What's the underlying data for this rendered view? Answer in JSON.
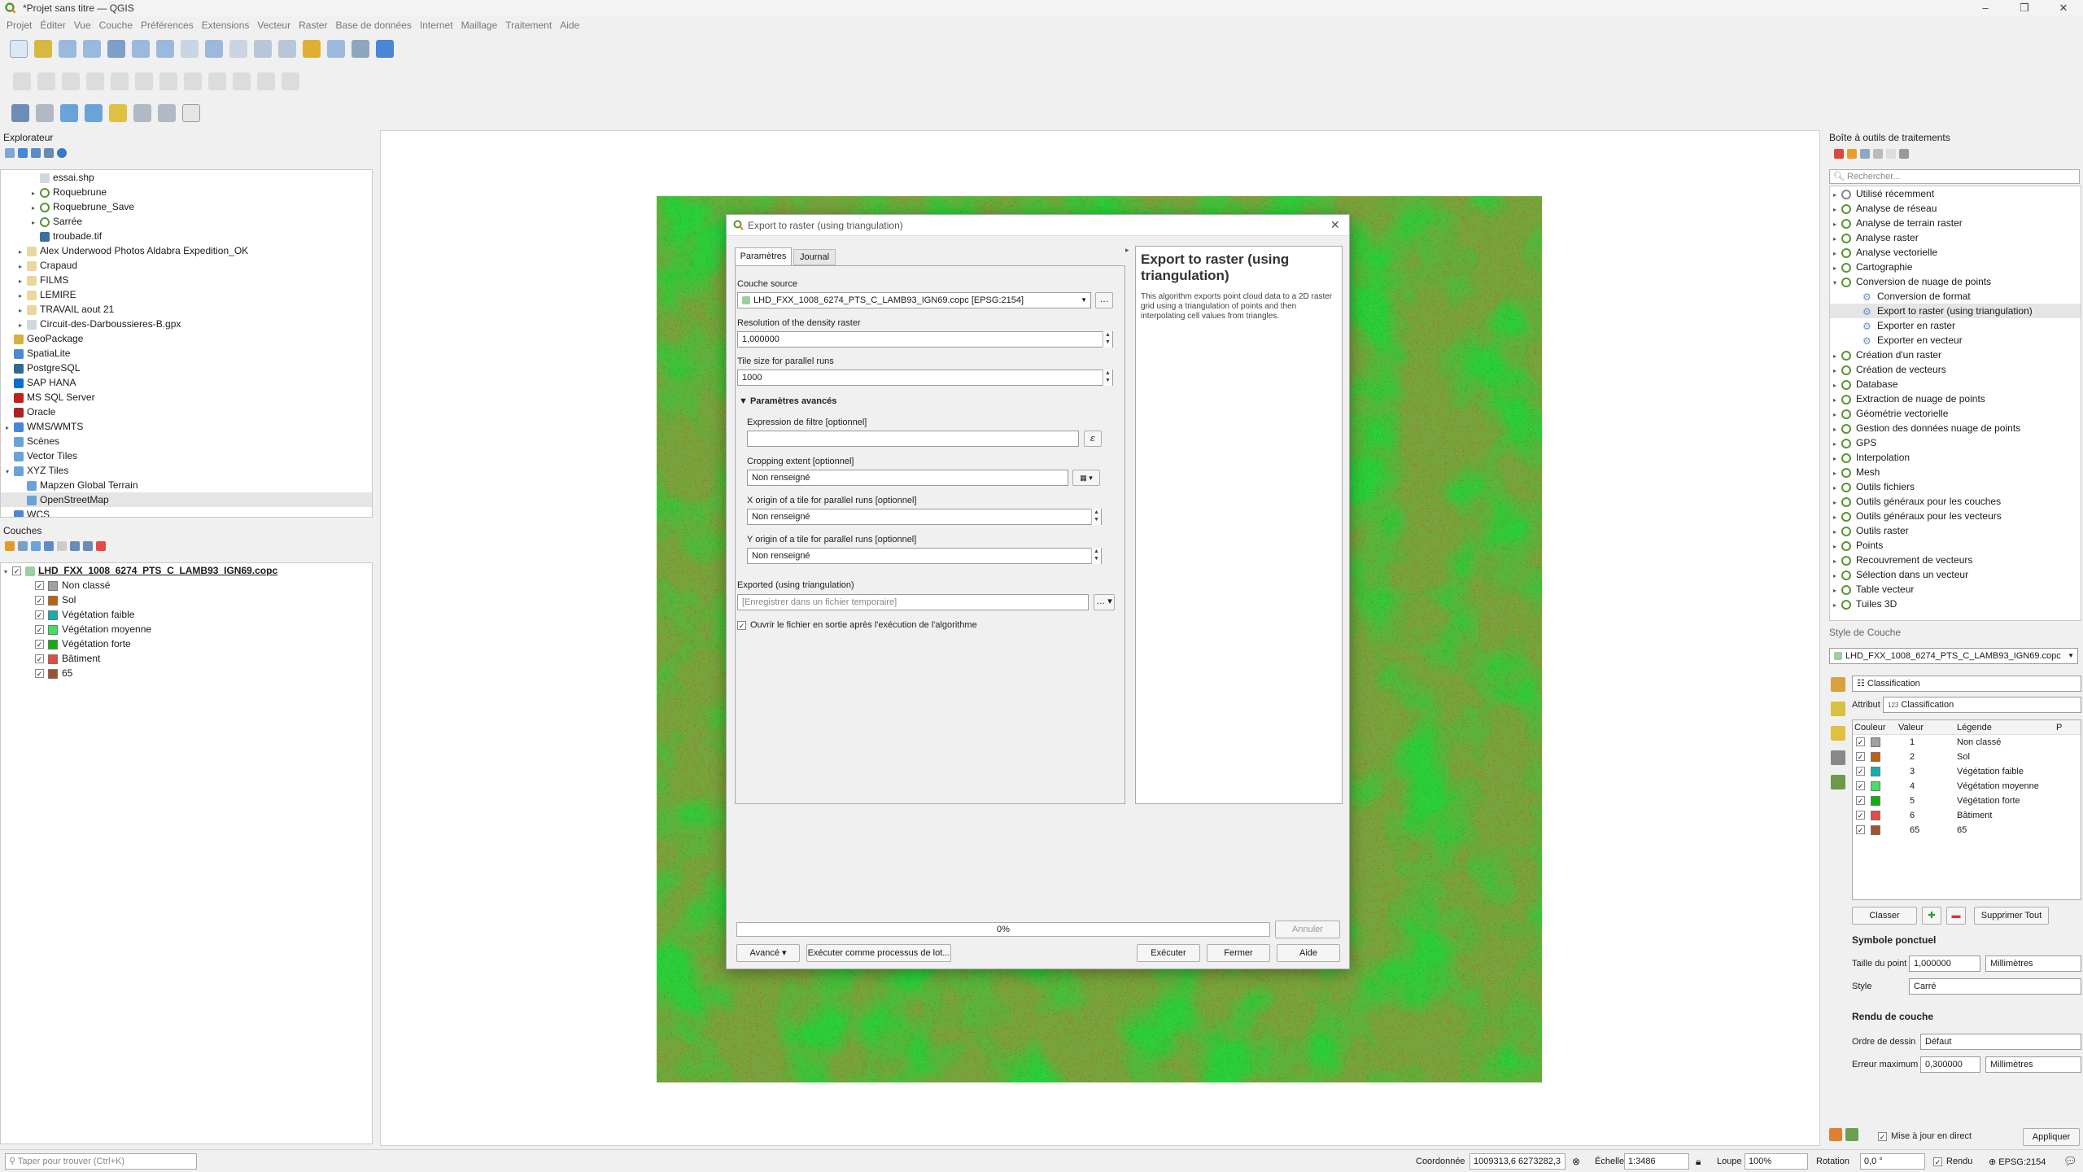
{
  "window": {
    "title": "*Projet sans titre — QGIS"
  },
  "menu": [
    "Projet",
    "Éditer",
    "Vue",
    "Couche",
    "Préférences",
    "Extensions",
    "Vecteur",
    "Raster",
    "Base de données",
    "Internet",
    "Maillage",
    "Traitement",
    "Aide"
  ],
  "explorer": {
    "title": "Explorateur",
    "items": [
      {
        "label": "essai.shp",
        "indent": 2,
        "icon": "file"
      },
      {
        "label": "Roquebrune",
        "indent": 2,
        "icon": "qgs",
        "arrow": "▸"
      },
      {
        "label": "Roquebrune_Save",
        "indent": 2,
        "icon": "qgs",
        "arrow": "▸"
      },
      {
        "label": "Sarrée",
        "indent": 2,
        "icon": "qgs",
        "arrow": "▸"
      },
      {
        "label": "troubade.tif",
        "indent": 2,
        "icon": "raster"
      },
      {
        "label": "Alex Underwood Photos Aldabra Expedition_OK",
        "indent": 1,
        "icon": "folder",
        "arrow": "▸"
      },
      {
        "label": "Crapaud",
        "indent": 1,
        "icon": "folder",
        "arrow": "▸"
      },
      {
        "label": "FILMS",
        "indent": 1,
        "icon": "folder",
        "arrow": "▸"
      },
      {
        "label": "LEMIRE",
        "indent": 1,
        "icon": "folder",
        "arrow": "▸"
      },
      {
        "label": "TRAVAIL aout 21",
        "indent": 1,
        "icon": "folder",
        "arrow": "▸"
      },
      {
        "label": "Circuit-des-Darboussieres-B.gpx",
        "indent": 1,
        "icon": "file",
        "arrow": "▸"
      },
      {
        "label": "GeoPackage",
        "indent": 0,
        "icon": "gpkg"
      },
      {
        "label": "SpatiaLite",
        "indent": 0,
        "icon": "spatialite"
      },
      {
        "label": "PostgreSQL",
        "indent": 0,
        "icon": "postgres"
      },
      {
        "label": "SAP HANA",
        "indent": 0,
        "icon": "hana"
      },
      {
        "label": "MS SQL Server",
        "indent": 0,
        "icon": "mssql"
      },
      {
        "label": "Oracle",
        "indent": 0,
        "icon": "oracle"
      },
      {
        "label": "WMS/WMTS",
        "indent": 0,
        "icon": "wms",
        "arrow": "▸"
      },
      {
        "label": "Scènes",
        "indent": 0,
        "icon": "scenes"
      },
      {
        "label": "Vector Tiles",
        "indent": 0,
        "icon": "vtiles"
      },
      {
        "label": "XYZ Tiles",
        "indent": 0,
        "icon": "xyz",
        "arrow": "▾"
      },
      {
        "label": "Mapzen Global Terrain",
        "indent": 1,
        "icon": "xyz"
      },
      {
        "label": "OpenStreetMap",
        "indent": 1,
        "icon": "xyz",
        "selected": true
      },
      {
        "label": "WCS",
        "indent": 0,
        "icon": "wcs"
      }
    ]
  },
  "layers": {
    "title": "Couches",
    "main": "LHD_FXX_1008_6274_PTS_C_LAMB93_IGN69.copc",
    "classes": [
      {
        "label": "Non classé",
        "color": "#a0a0a0"
      },
      {
        "label": "Sol",
        "color": "#c06010"
      },
      {
        "label": "Végétation faible",
        "color": "#10b0b0"
      },
      {
        "label": "Végétation moyenne",
        "color": "#40e060"
      },
      {
        "label": "Végétation forte",
        "color": "#10b010"
      },
      {
        "label": "Bâtiment",
        "color": "#e84848"
      },
      {
        "label": "65",
        "color": "#a0522d"
      }
    ]
  },
  "dialog": {
    "title": "Export to raster (using triangulation)",
    "tabs": [
      "Paramètres",
      "Journal"
    ],
    "source_label": "Couche source",
    "source_value": "LHD_FXX_1008_6274_PTS_C_LAMB93_IGN69.copc [EPSG:2154]",
    "resolution_label": "Resolution of the density raster",
    "resolution_value": "1,000000",
    "tile_label": "Tile size for parallel runs",
    "tile_value": "1000",
    "advanced_label": "Paramètres avancés",
    "filter_label": "Expression de filtre [optionnel]",
    "crop_label": "Cropping extent [optionnel]",
    "crop_value": "Non renseigné",
    "xorigin_label": "X origin of a tile for parallel runs [optionnel]",
    "xorigin_value": "Non renseigné",
    "yorigin_label": "Y origin of a tile for parallel runs [optionnel]",
    "yorigin_value": "Non renseigné",
    "exported_label": "Exported (using triangulation)",
    "exported_placeholder": "[Enregistrer dans un fichier temporaire]",
    "open_label": "Ouvrir le fichier en sortie après l'exécution de l'algorithme",
    "help_title": "Export to raster (using triangulation)",
    "help_text": "This algorithm exports point cloud data to a 2D raster grid using a triangulation of points and then interpolating cell values from triangles.",
    "progress": "0%",
    "progress_value": 0,
    "cancel": "Annuler",
    "advanced_btn": "Avancé",
    "batch_btn": "Exécuter comme processus de lot...",
    "run_btn": "Exécuter",
    "close_btn": "Fermer",
    "help_btn": "Aide"
  },
  "toolbox": {
    "title": "Boîte à outils de traitements",
    "search_placeholder": "Rechercher...",
    "groups": [
      {
        "label": "Utilisé récemment",
        "icon": "recent"
      },
      {
        "label": "Analyse de réseau"
      },
      {
        "label": "Analyse de terrain raster"
      },
      {
        "label": "Analyse raster"
      },
      {
        "label": "Analyse vectorielle"
      },
      {
        "label": "Cartographie"
      },
      {
        "label": "Conversion de nuage de points",
        "open": true
      },
      {
        "label": "Conversion de format",
        "child": true
      },
      {
        "label": "Export to raster (using triangulation)",
        "child": true,
        "selected": true
      },
      {
        "label": "Exporter en raster",
        "child": true
      },
      {
        "label": "Exporter en vecteur",
        "child": true
      },
      {
        "label": "Création d'un raster"
      },
      {
        "label": "Création de vecteurs"
      },
      {
        "label": "Database"
      },
      {
        "label": "Extraction de nuage de points"
      },
      {
        "label": "Géométrie vectorielle"
      },
      {
        "label": "Gestion des données nuage de points"
      },
      {
        "label": "GPS"
      },
      {
        "label": "Interpolation"
      },
      {
        "label": "Mesh"
      },
      {
        "label": "Outils fichiers"
      },
      {
        "label": "Outils généraux pour les couches"
      },
      {
        "label": "Outils généraux pour les vecteurs"
      },
      {
        "label": "Outils raster"
      },
      {
        "label": "Points"
      },
      {
        "label": "Recouvrement de vecteurs"
      },
      {
        "label": "Sélection dans un vecteur"
      },
      {
        "label": "Table vecteur"
      },
      {
        "label": "Tuiles 3D"
      }
    ]
  },
  "style": {
    "title": "Style de Couche",
    "layer": "LHD_FXX_1008_6274_PTS_C_LAMB93_IGN69.copc",
    "renderer": "Classification",
    "attr_label": "Attribut",
    "attr_value": "Classification",
    "attr_prefix": "123",
    "cols": [
      "Couleur",
      "Valeur",
      "Légende",
      "P"
    ],
    "rows": [
      {
        "value": "1",
        "legend": "Non classé",
        "color": "#a0a0a0"
      },
      {
        "value": "2",
        "legend": "Sol",
        "color": "#c06010"
      },
      {
        "value": "3",
        "legend": "Végétation faible",
        "color": "#10b0b0"
      },
      {
        "value": "4",
        "legend": "Végétation moyenne",
        "color": "#40e060"
      },
      {
        "value": "5",
        "legend": "Végétation forte",
        "color": "#10b010"
      },
      {
        "value": "6",
        "legend": "Bâtiment",
        "color": "#e84848"
      },
      {
        "value": "65",
        "legend": "65",
        "color": "#a0522d"
      }
    ],
    "classify_btn": "Classer",
    "delete_all_btn": "Supprimer Tout",
    "point_symbol": "Symbole ponctuel",
    "size_label": "Taille du point",
    "size_value": "1,000000",
    "size_unit": "Millimètres",
    "style_label": "Style",
    "style_value": "Carré",
    "render_title": "Rendu de couche",
    "order_label": "Ordre de dessin",
    "order_value": "Défaut",
    "error_label": "Erreur maximum",
    "error_value": "0,300000",
    "error_unit": "Millimètres",
    "live_label": "Mise à jour en direct",
    "apply_btn": "Appliquer"
  },
  "status": {
    "search_placeholder": "Taper pour trouver (Ctrl+K)",
    "coord_label": "Coordonnée",
    "coord_value": "1009313,6  6273282,3",
    "scale_label": "Échelle",
    "scale_value": "1:3486",
    "magnifier_label": "Loupe",
    "magnifier_value": "100%",
    "rotation_label": "Rotation",
    "rotation_value": "0,0 °",
    "render_label": "Rendu",
    "crs": "EPSG:2154"
  }
}
